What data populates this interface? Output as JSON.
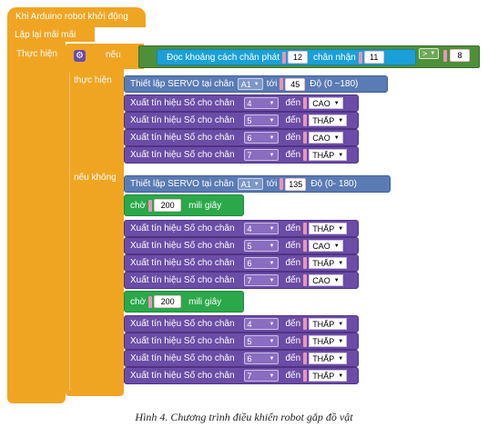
{
  "hat_label": "Khi Arduino robot khởi động",
  "loop_label": "Lặp lại mãi mãi",
  "do_label": "Thực hiện",
  "if_label": "nếu",
  "then_label": "thực hiện",
  "else_label": "nếu không",
  "distance": {
    "label": "Đọc khoảng cách chân phát",
    "trig": "12",
    "echo_label": "chân nhận",
    "echo": "11"
  },
  "compare": {
    "op": ">",
    "value": "8"
  },
  "servo1": {
    "label": "Thiết lập SERVO tại chân",
    "pin": "A1",
    "to": "tới",
    "angle": "45",
    "unit": "Độ (0 ~180)"
  },
  "servo2": {
    "label": "Thiết lập SERVO tại chân",
    "pin": "A1",
    "to": "tới",
    "angle": "135",
    "unit": "Độ (0- 180)"
  },
  "wait": {
    "label": "chờ",
    "value": "200",
    "unit": "mili giây"
  },
  "dw_label": "Xuất tín hiệu Số cho chân",
  "dw_to": "đến",
  "group1": [
    {
      "pin": "4",
      "state": "CAO"
    },
    {
      "pin": "5",
      "state": "THẤP"
    },
    {
      "pin": "6",
      "state": "CAO"
    },
    {
      "pin": "7",
      "state": "THẤP"
    }
  ],
  "group2": [
    {
      "pin": "4",
      "state": "THẤP"
    },
    {
      "pin": "5",
      "state": "CAO"
    },
    {
      "pin": "6",
      "state": "THẤP"
    },
    {
      "pin": "7",
      "state": "CAO"
    }
  ],
  "group3": [
    {
      "pin": "4",
      "state": "THẤP"
    },
    {
      "pin": "5",
      "state": "THẤP"
    },
    {
      "pin": "6",
      "state": "THẤP"
    },
    {
      "pin": "7",
      "state": "THẤP"
    }
  ],
  "caption": "Hình 4. Chương trình điều khiển robot gắp đồ vật"
}
